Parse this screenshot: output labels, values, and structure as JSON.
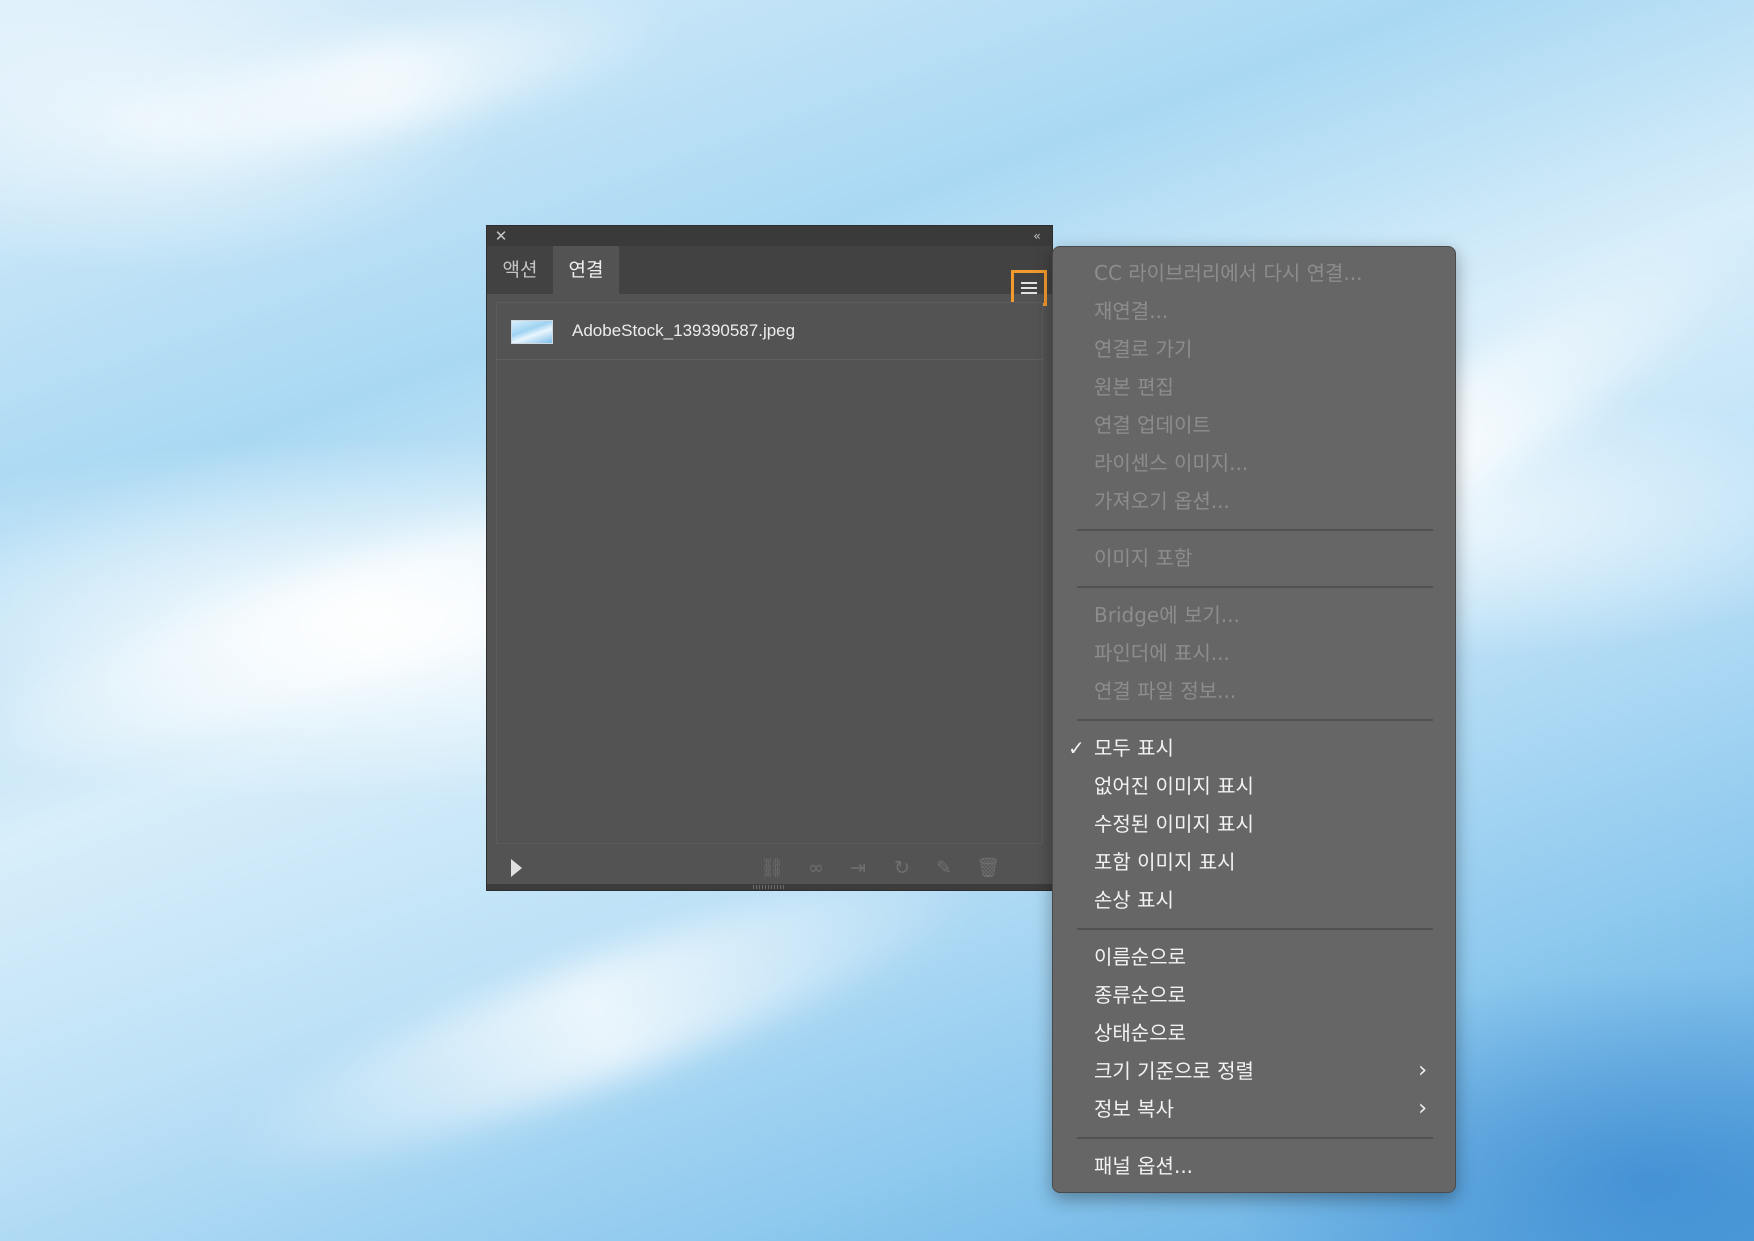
{
  "panel": {
    "tabs": [
      {
        "label": "액션",
        "active": false
      },
      {
        "label": "연결",
        "active": true
      }
    ],
    "close_glyph": "✕",
    "collapse_glyph": "‹‹",
    "links": [
      {
        "filename": "AdobeStock_139390587.jpeg"
      }
    ],
    "footer_icons": [
      "relink-from-cc-libraries-icon",
      "relink-icon",
      "go-to-link-icon",
      "update-link-icon",
      "edit-original-icon",
      "delete-icon"
    ]
  },
  "menu": {
    "groups": [
      [
        {
          "label": "CC 라이브러리에서 다시 연결...",
          "enabled": false
        },
        {
          "label": "재연결...",
          "enabled": false
        },
        {
          "label": "연결로 가기",
          "enabled": false
        },
        {
          "label": "원본 편집",
          "enabled": false
        },
        {
          "label": "연결 업데이트",
          "enabled": false
        },
        {
          "label": "라이센스 이미지...",
          "enabled": false
        },
        {
          "label": "가져오기 옵션...",
          "enabled": false
        }
      ],
      [
        {
          "label": "이미지 포함",
          "enabled": false
        }
      ],
      [
        {
          "label": "Bridge에 보기...",
          "enabled": false
        },
        {
          "label": "파인더에 표시...",
          "enabled": false
        },
        {
          "label": "연결 파일 정보...",
          "enabled": false
        }
      ],
      [
        {
          "label": "모두 표시",
          "enabled": true,
          "checked": true
        },
        {
          "label": "없어진 이미지 표시",
          "enabled": true
        },
        {
          "label": "수정된 이미지 표시",
          "enabled": true
        },
        {
          "label": "포함 이미지 표시",
          "enabled": true
        },
        {
          "label": "손상 표시",
          "enabled": true
        }
      ],
      [
        {
          "label": "이름순으로",
          "enabled": true
        },
        {
          "label": "종류순으로",
          "enabled": true
        },
        {
          "label": "상태순으로",
          "enabled": true
        },
        {
          "label": "크기 기준으로 정렬",
          "enabled": true,
          "submenu": true
        },
        {
          "label": "정보 복사",
          "enabled": true,
          "submenu": true
        }
      ],
      [
        {
          "label": "패널 옵션...",
          "enabled": true
        }
      ]
    ],
    "check_glyph": "✓",
    "submenu_glyph": "›"
  },
  "colors": {
    "highlight_border": "#f29a2e",
    "panel_bg": "#535353",
    "menu_bg": "#666666"
  }
}
